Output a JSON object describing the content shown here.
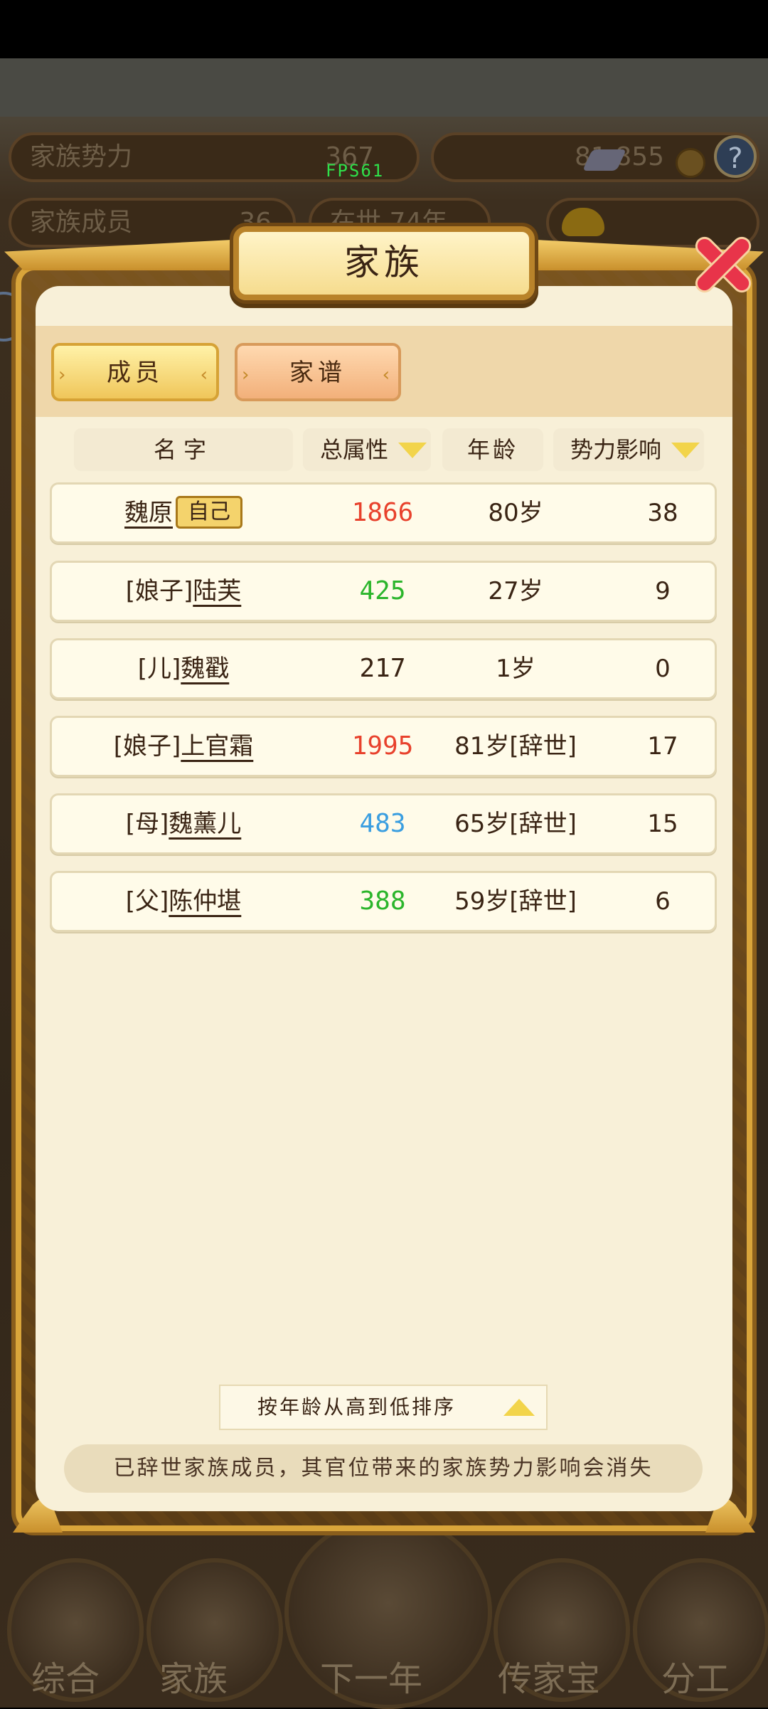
{
  "background": {
    "fps": "FPS61",
    "stats": {
      "clan_power_label": "家族势力",
      "clan_power_value": "367",
      "clan_members_label": "家族成员",
      "clan_members_value": "36",
      "era_text": "在世 74年",
      "currency": "81 855"
    },
    "help": "?",
    "nav": [
      "综合",
      "家族",
      "下一年",
      "传家宝",
      "分工"
    ]
  },
  "dialog": {
    "title": "家族",
    "tabs": {
      "members": "成员",
      "genealogy": "家谱"
    },
    "columns": {
      "name": "名字",
      "total_attr": "总属性",
      "age": "年龄",
      "influence": "势力影响"
    },
    "self_tag": "自己",
    "rows": [
      {
        "prefix": "",
        "name": "魏原",
        "attr": "1866",
        "attr_color": "#e8412c",
        "age": "80岁",
        "influence": "38"
      },
      {
        "prefix": "[娘子]",
        "name": "陆芙",
        "attr": "425",
        "attr_color": "#2bb52b",
        "age": "27岁",
        "influence": "9"
      },
      {
        "prefix": "[儿]",
        "name": "魏戳",
        "attr": "217",
        "attr_color": "#3a2414",
        "age": "1岁",
        "influence": "0"
      },
      {
        "prefix": "[娘子]",
        "name": "上官霜",
        "attr": "1995",
        "attr_color": "#e8412c",
        "age": "81岁[辞世]",
        "influence": "17"
      },
      {
        "prefix": "[母]",
        "name": "魏薰儿",
        "attr": "483",
        "attr_color": "#3a9ee0",
        "age": "65岁[辞世]",
        "influence": "15"
      },
      {
        "prefix": "[父]",
        "name": "陈仲堪",
        "attr": "388",
        "attr_color": "#2bb52b",
        "age": "59岁[辞世]",
        "influence": "6"
      }
    ],
    "sort_label": "按年龄从高到低排序",
    "notice": "已辞世家族成员，其官位带来的家族势力影响会消失"
  }
}
